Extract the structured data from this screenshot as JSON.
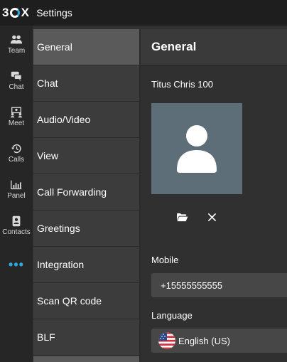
{
  "app": {
    "logo_num": "3",
    "logo_cx": "X",
    "title": "Settings"
  },
  "rail": {
    "items": [
      {
        "label": "Team",
        "icon": "team-icon"
      },
      {
        "label": "Chat",
        "icon": "chat-icon"
      },
      {
        "label": "Meet",
        "icon": "meet-icon"
      },
      {
        "label": "Calls",
        "icon": "history-icon"
      },
      {
        "label": "Panel",
        "icon": "panel-icon"
      },
      {
        "label": "Contacts",
        "icon": "contacts-icon"
      }
    ],
    "more": "•••"
  },
  "menu": {
    "items": [
      {
        "label": "General",
        "active": true
      },
      {
        "label": "Chat"
      },
      {
        "label": "Audio/Video"
      },
      {
        "label": "View"
      },
      {
        "label": "Call Forwarding"
      },
      {
        "label": "Greetings"
      },
      {
        "label": "Integration"
      },
      {
        "label": "Scan QR code"
      },
      {
        "label": "BLF"
      }
    ]
  },
  "content": {
    "heading": "General",
    "user_name": "Titus Chris 100",
    "avatar_bg": "#5e6e78",
    "mobile_label": "Mobile",
    "mobile_value": "+15555555555",
    "language_label": "Language",
    "language_value": "English (US)",
    "language_flag": "us-flag-icon"
  },
  "colors": {
    "accent": "#2da7e0",
    "active_menu": "#5a5a5a"
  }
}
